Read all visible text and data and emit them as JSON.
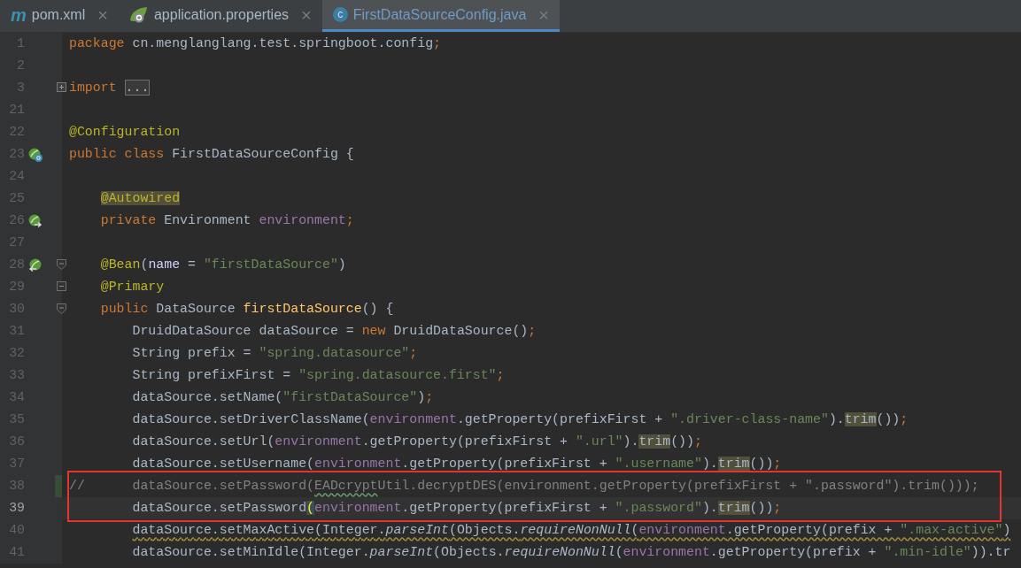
{
  "tabs": [
    {
      "kind": "maven",
      "icon_text": "m",
      "label": "pom.xml",
      "close": "×",
      "selected": false
    },
    {
      "kind": "spring",
      "label": "application.properties",
      "close": "×",
      "selected": false
    },
    {
      "kind": "class",
      "icon_text": "c",
      "label": "FirstDataSourceConfig.java",
      "close": "×",
      "selected": true
    }
  ],
  "editor": {
    "lines": [
      {
        "number": "1",
        "segments": [
          {
            "kind": "kw",
            "t": "package"
          },
          {
            "kind": "plain",
            "t": " cn.menglanglang.test.springboot.config"
          },
          {
            "kind": "semi",
            "t": ";"
          }
        ]
      },
      {
        "number": "2"
      },
      {
        "number": "3",
        "fold_marker": {
          "kind": "collapsed"
        },
        "segments": [
          {
            "kind": "kw",
            "t": "import "
          },
          {
            "kind": "folded",
            "t": "..."
          }
        ]
      },
      {
        "number": "21"
      },
      {
        "number": "22",
        "segments": [
          {
            "kind": "ann",
            "t": "@Configuration"
          }
        ]
      },
      {
        "number": "23",
        "gutter_marker": {
          "kind": "bean_class"
        },
        "segments": [
          {
            "kind": "kw",
            "t": "public class"
          },
          {
            "kind": "plain",
            "t": " FirstDataSourceConfig {"
          }
        ]
      },
      {
        "number": "24"
      },
      {
        "number": "25",
        "segments": [
          {
            "kind": "ann",
            "t": "    @Autowired",
            "highlighted": true
          }
        ]
      },
      {
        "number": "26",
        "gutter_marker": {
          "kind": "injected"
        },
        "segments": [
          {
            "kind": "kw",
            "t": "    private"
          },
          {
            "kind": "plain",
            "t": " Environment "
          },
          {
            "kind": "field",
            "t": "environment"
          },
          {
            "kind": "semi",
            "t": ";"
          }
        ]
      },
      {
        "number": "27"
      },
      {
        "number": "28",
        "gutter_marker": {
          "kind": "bean_method"
        },
        "fold_marker": {
          "kind": "start"
        },
        "segments": [
          {
            "kind": "ann",
            "t": "    @Bean"
          },
          {
            "kind": "plain",
            "t": "("
          },
          {
            "kind": "param",
            "t": "name"
          },
          {
            "kind": "plain",
            "t": " = "
          },
          {
            "kind": "str",
            "t": "\"firstDataSource\""
          },
          {
            "kind": "plain",
            "t": ")"
          }
        ]
      },
      {
        "number": "29",
        "fold_marker": {
          "kind": "middle"
        },
        "segments": [
          {
            "kind": "ann",
            "t": "    @Primary"
          }
        ]
      },
      {
        "number": "30",
        "fold_marker": {
          "kind": "start"
        },
        "segments": [
          {
            "kind": "kw",
            "t": "    public"
          },
          {
            "kind": "plain",
            "t": " DataSource "
          },
          {
            "kind": "fn",
            "t": "firstDataSource"
          },
          {
            "kind": "plain",
            "t": "() {"
          }
        ]
      },
      {
        "number": "31",
        "segments": [
          {
            "kind": "plain",
            "t": "        DruidDataSource dataSource = "
          },
          {
            "kind": "kw",
            "t": "new"
          },
          {
            "kind": "plain",
            "t": " DruidDataSource()"
          },
          {
            "kind": "semi",
            "t": ";"
          }
        ]
      },
      {
        "number": "32",
        "segments": [
          {
            "kind": "plain",
            "t": "        String prefix = "
          },
          {
            "kind": "str",
            "t": "\"spring.datasource\""
          },
          {
            "kind": "semi",
            "t": ";"
          }
        ]
      },
      {
        "number": "33",
        "segments": [
          {
            "kind": "plain",
            "t": "        String prefixFirst = "
          },
          {
            "kind": "str",
            "t": "\"spring.datasource.first\""
          },
          {
            "kind": "semi",
            "t": ";"
          }
        ]
      },
      {
        "number": "34",
        "segments": [
          {
            "kind": "plain",
            "t": "        dataSource.setName("
          },
          {
            "kind": "str",
            "t": "\"firstDataSource\""
          },
          {
            "kind": "plain",
            "t": ")"
          },
          {
            "kind": "semi",
            "t": ";"
          }
        ]
      },
      {
        "number": "35",
        "segments": [
          {
            "kind": "plain",
            "t": "        dataSource.setDriverClassName("
          },
          {
            "kind": "field",
            "t": "environment"
          },
          {
            "kind": "plain",
            "t": ".getProperty(prefixFirst + "
          },
          {
            "kind": "str",
            "t": "\".driver-class-name\""
          },
          {
            "kind": "plain",
            "t": ")."
          },
          {
            "kind": "plain",
            "t": "trim",
            "highlighted": true
          },
          {
            "kind": "plain",
            "t": "())"
          },
          {
            "kind": "semi",
            "t": ";"
          }
        ]
      },
      {
        "number": "36",
        "segments": [
          {
            "kind": "plain",
            "t": "        dataSource.setUrl("
          },
          {
            "kind": "field",
            "t": "environment"
          },
          {
            "kind": "plain",
            "t": ".getProperty(prefixFirst + "
          },
          {
            "kind": "str",
            "t": "\".url\""
          },
          {
            "kind": "plain",
            "t": ")."
          },
          {
            "kind": "plain",
            "t": "trim",
            "highlighted": true
          },
          {
            "kind": "plain",
            "t": "())"
          },
          {
            "kind": "semi",
            "t": ";"
          }
        ]
      },
      {
        "number": "37",
        "segments": [
          {
            "kind": "plain",
            "t": "        dataSource.setUsername("
          },
          {
            "kind": "field",
            "t": "environment"
          },
          {
            "kind": "plain",
            "t": ".getProperty(prefixFirst + "
          },
          {
            "kind": "str",
            "t": "\".username\""
          },
          {
            "kind": "plain",
            "t": ")."
          },
          {
            "kind": "plain",
            "t": "trim",
            "highlighted": true
          },
          {
            "kind": "plain",
            "t": "())"
          },
          {
            "kind": "semi",
            "t": ";"
          }
        ]
      },
      {
        "number": "38",
        "changed": true,
        "boxed": true,
        "segments": [
          {
            "kind": "comment",
            "t": "//      dataSource.setPassword("
          },
          {
            "kind": "comment",
            "t": "EADcrypt",
            "misspelled": true
          },
          {
            "kind": "comment",
            "t": "Util.decryptDES(environment.getProperty(prefixFirst + \".password\").trim()));"
          }
        ]
      },
      {
        "number": "39",
        "current": true,
        "boxed": true,
        "segments": [
          {
            "kind": "plain",
            "t": "        dataSource.setPassword"
          },
          {
            "kind": "plain",
            "t": "(",
            "matched": true
          },
          {
            "kind": "field",
            "t": "environment"
          },
          {
            "kind": "plain",
            "t": ".getProperty(prefixFirst + "
          },
          {
            "kind": "str",
            "t": "\".password\""
          },
          {
            "kind": "plain",
            "t": ")."
          },
          {
            "kind": "plain",
            "t": "trim",
            "highlighted": true
          },
          {
            "kind": "plain",
            "t": "())"
          },
          {
            "kind": "semi",
            "t": ";"
          }
        ]
      },
      {
        "number": "40",
        "segments": [
          {
            "kind": "plain",
            "t": "        dataSource.setMaxActive(Integer.",
            "warning": true
          },
          {
            "kind": "static",
            "t": "parseInt",
            "warning": true
          },
          {
            "kind": "plain",
            "t": "(Objects.",
            "warning": true
          },
          {
            "kind": "static",
            "t": "requireNonNull",
            "warning": true
          },
          {
            "kind": "plain",
            "t": "(",
            "warning": true
          },
          {
            "kind": "field",
            "t": "environment",
            "warning": true
          },
          {
            "kind": "plain",
            "t": ".getProperty(prefix + ",
            "warning": true
          },
          {
            "kind": "str",
            "t": "\".max-active\"",
            "warning": true
          },
          {
            "kind": "plain",
            "t": ")",
            "warning": true
          }
        ]
      },
      {
        "number": "41",
        "segments": [
          {
            "kind": "plain",
            "t": "        dataSource.setMinIdle(Integer."
          },
          {
            "kind": "static",
            "t": "parseInt"
          },
          {
            "kind": "plain",
            "t": "(Objects."
          },
          {
            "kind": "static",
            "t": "requireNonNull"
          },
          {
            "kind": "plain",
            "t": "("
          },
          {
            "kind": "field",
            "t": "environment"
          },
          {
            "kind": "plain",
            "t": ".getProperty(prefix + "
          },
          {
            "kind": "str",
            "t": "\".min-idle\""
          },
          {
            "kind": "plain",
            "t": ")).tr"
          }
        ]
      }
    ]
  }
}
